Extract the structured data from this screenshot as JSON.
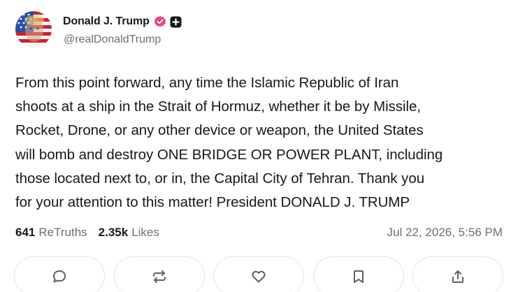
{
  "author": {
    "display_name": "Donald J. Trump",
    "handle": "@realDonaldTrump",
    "avatar_icon": "flag-portrait-avatar",
    "verified_icon": "verified-badge-icon",
    "verified_color": "#e8457a",
    "plus_icon": "plus-badge-icon"
  },
  "post": {
    "text": "From this point forward, any time the Islamic Republic of Iran\nshoots at a ship in the Strait of Hormuz, whether it be by Missile,\nRocket, Drone, or any other device or weapon, the United States\nwill bomb and destroy ONE BRIDGE OR POWER PLANT, including\nthose located next to, or in, the Capital City of Tehran. Thank you\nfor your attention to this matter! President DONALD J. TRUMP"
  },
  "stats": {
    "retruths_count": "641",
    "retruths_label": "ReTruths",
    "likes_count": "2.35k",
    "likes_label": "Likes",
    "timestamp": "Jul 22, 2026, 5:56 PM"
  },
  "actions": [
    {
      "icon": "reply-icon"
    },
    {
      "icon": "retruth-icon"
    },
    {
      "icon": "like-icon"
    },
    {
      "icon": "bookmark-icon"
    },
    {
      "icon": "share-icon"
    }
  ],
  "colors": {
    "text_primary": "#16181c",
    "text_secondary": "#6b6f76",
    "border": "#e3e5e8",
    "icon": "#5d6168"
  }
}
